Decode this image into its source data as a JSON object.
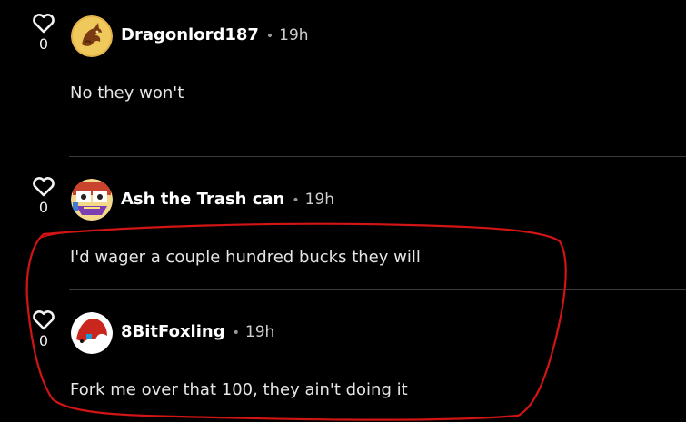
{
  "comments": [
    {
      "author": "Dragonlord187",
      "separator": "•",
      "time": "19h",
      "text": "No they won't",
      "likes": "0",
      "avatar_icon": "dragon-avatar-icon"
    },
    {
      "author": "Ash the Trash can",
      "separator": "•",
      "time": "19h",
      "text": "I'd wager a couple hundred bucks they will",
      "likes": "0",
      "avatar_icon": "cartoon-avatar-icon"
    },
    {
      "author": "8BitFoxling",
      "separator": "•",
      "time": "19h",
      "text": "Fork me over that 100, they ain't doing it",
      "likes": "0",
      "avatar_icon": "fox-avatar-icon"
    }
  ],
  "colors": {
    "background": "#000000",
    "text": "#e6e6e6",
    "divider": "#3b3b3b",
    "annotation": "#d11414"
  }
}
